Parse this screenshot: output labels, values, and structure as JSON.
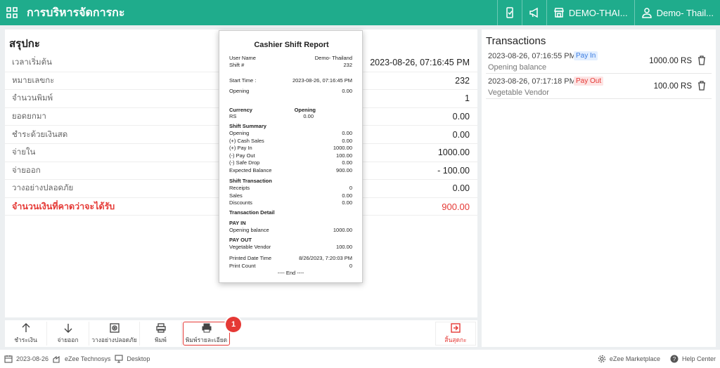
{
  "header": {
    "title": "การบริหารจัดการกะ",
    "property": "DEMO-THAI...",
    "user": "Demo- Thail..."
  },
  "summary": {
    "title": "สรุปกะ",
    "rows": [
      {
        "label": "เวลาเริ่มต้น",
        "value": "2023-08-26, 07:16:45 PM"
      },
      {
        "label": "หมายเลขกะ",
        "value": "232"
      },
      {
        "label": "จำนวนพิมพ์",
        "value": "1"
      },
      {
        "label": "ยอดยกมา",
        "value": "0.00"
      },
      {
        "label": "ชำระด้วยเงินสด",
        "value": "0.00"
      },
      {
        "label": "จ่ายใน",
        "value": "1000.00"
      },
      {
        "label": "จ่ายออก",
        "value": "- 100.00"
      },
      {
        "label": "วางอย่างปลอดภัย",
        "value": "0.00"
      },
      {
        "label": "จำนวนเงินที่คาดว่าจะได้รับ",
        "value": "900.00"
      }
    ]
  },
  "transactions": {
    "title": "Transactions",
    "items": [
      {
        "time": "2023-08-26, 07:16:55 PM",
        "type": "Pay In",
        "desc": "Opening balance",
        "amount": "1000.00 RS"
      },
      {
        "time": "2023-08-26, 07:17:18 PM",
        "type": "Pay Out",
        "desc": "Vegetable Vendor",
        "amount": "100.00 RS"
      }
    ]
  },
  "toolbar": {
    "pay": "ชำระเงิน",
    "payout": "จ่ายออก",
    "safedrop": "วางอย่างปลอดภัย",
    "print": "พิมพ์",
    "print_detail": "พิมพ์รายละเอียด",
    "end_shift": "สิ้นสุดกะ",
    "step": "1"
  },
  "footer": {
    "date": "2023-08-26",
    "company": "eZee Technosys",
    "device": "Desktop",
    "marketplace": "eZee Marketplace",
    "help": "Help Center"
  },
  "receipt": {
    "title": "Cashier Shift Report",
    "user_label": "User Name",
    "user_value": "Demo- Thailand",
    "shift_label": "Shift #",
    "shift_value": "232",
    "start_label": "Start Time :",
    "start_value": "2023-08-26, 07:16:45 PM",
    "opening_label": "Opening",
    "opening_value": "0.00",
    "currency_label": "Currency",
    "currency_opening_label": "Opening",
    "rs_label": "RS",
    "rs_value": "0.00",
    "summary_title": "Shift Summary",
    "summary": [
      {
        "label": "Opening",
        "value": "0.00"
      },
      {
        "label": "(+) Cash Sales",
        "value": "0.00"
      },
      {
        "label": "(+) Pay In",
        "value": "1000.00"
      },
      {
        "label": "(-) Pay Out",
        "value": "100.00"
      },
      {
        "label": "(-) Safe Drop",
        "value": "0.00"
      },
      {
        "label": "Expected Balance",
        "value": "900.00"
      }
    ],
    "transaction_title": "Shift Transaction",
    "transaction": [
      {
        "label": "Receipts",
        "value": "0"
      },
      {
        "label": "Sales",
        "value": "0.00"
      },
      {
        "label": "Discounts",
        "value": "0.00"
      }
    ],
    "detail_title": "Transaction Detail",
    "payin_title": "PAY IN",
    "payin_label": "Opening balance",
    "payin_value": "1000.00",
    "payout_title": "PAY OUT",
    "payout_label": "Vegetable Vendor",
    "payout_value": "100.00",
    "printed_label": "Printed Date Time",
    "printed_value": "8/26/2023, 7:20:03 PM",
    "count_label": "Print Count",
    "count_value": "0",
    "end": "---- End ----"
  }
}
